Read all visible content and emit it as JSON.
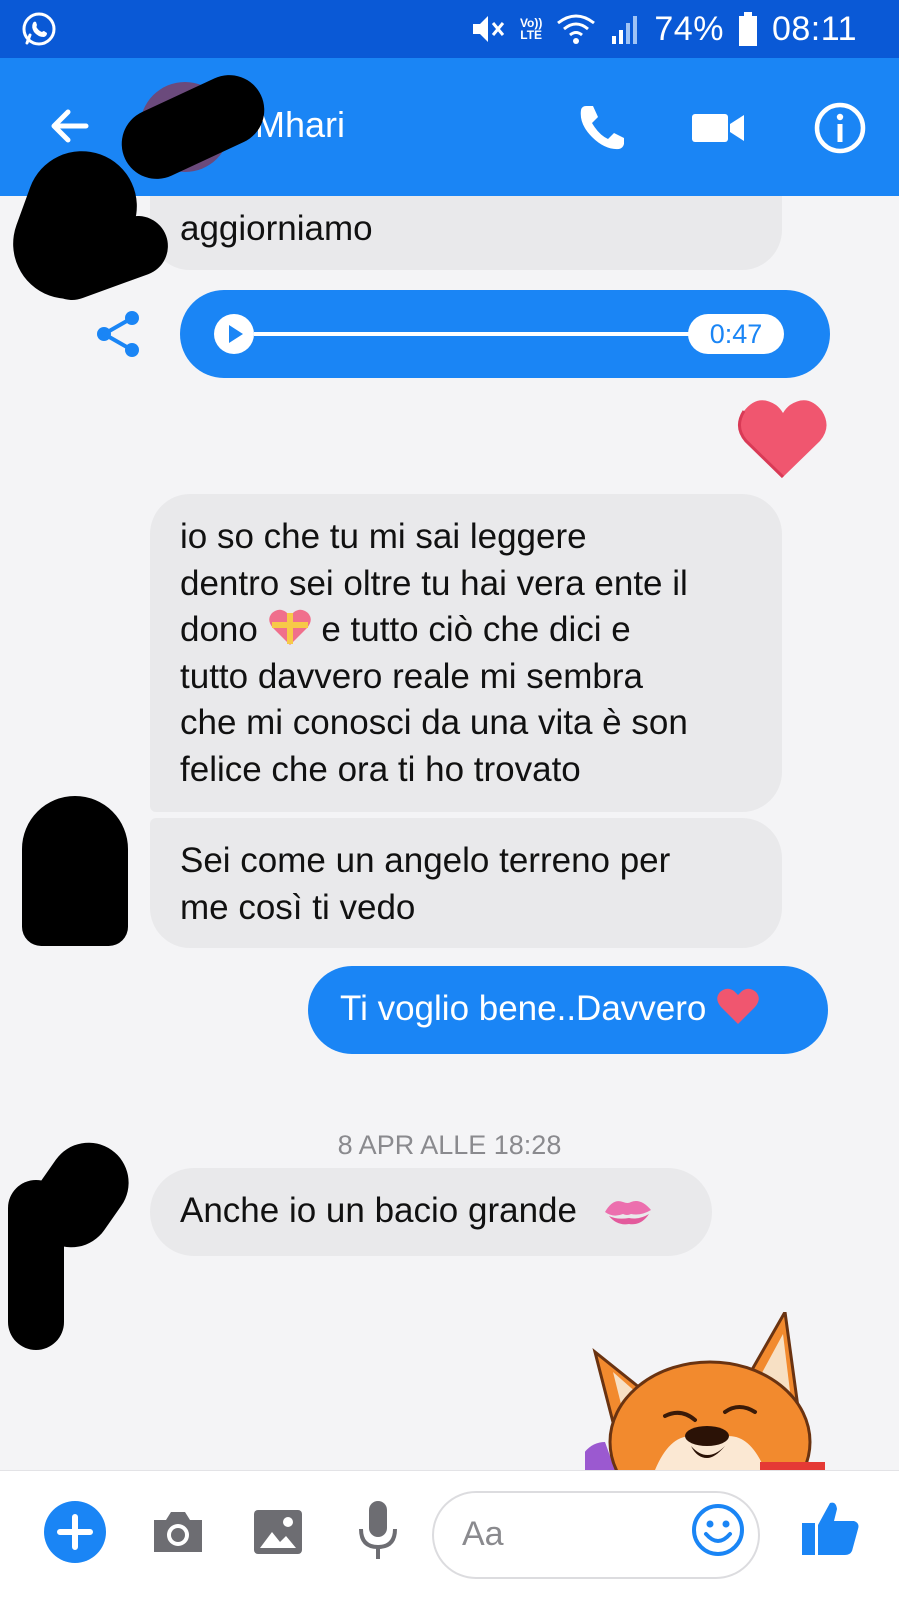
{
  "status_bar": {
    "volte_top": "Vo))",
    "volte_bottom": "LTE",
    "battery": "74%",
    "time": "08:11"
  },
  "header": {
    "contact_name": "Mhari"
  },
  "messages": [
    {
      "direction": "incoming",
      "text": "aggiorniamo"
    },
    {
      "direction": "outgoing",
      "type": "audio",
      "duration": "0:47"
    },
    {
      "direction": "outgoing",
      "type": "reaction",
      "icon": "heart-icon"
    },
    {
      "direction": "incoming",
      "lines": [
        "io so che tu mi sai leggere",
        "dentro sei oltre tu hai vera ente il",
        "dono",
        "e tutto ciò che dici e",
        "tutto davvero reale mi sembra",
        "che mi conosci da una vita è son",
        "felice che ora ti ho trovato"
      ]
    },
    {
      "direction": "incoming",
      "lines": [
        "Sei come un angelo terreno per",
        "me così ti vedo"
      ]
    },
    {
      "direction": "outgoing",
      "text": "Ti voglio bene..Davvero"
    },
    {
      "direction": "incoming",
      "text": "Anche io un bacio grande"
    },
    {
      "direction": "outgoing",
      "type": "sticker",
      "icon": "fox-sticker-icon"
    }
  ],
  "timestamp": "8 APR ALLE 18:28",
  "composer": {
    "placeholder": "Aa"
  },
  "colors": {
    "status_bar": "#0a59d6",
    "brand_blue": "#1a85f5",
    "incoming_bubble": "#e9e9eb",
    "background": "#f4f4f6"
  }
}
